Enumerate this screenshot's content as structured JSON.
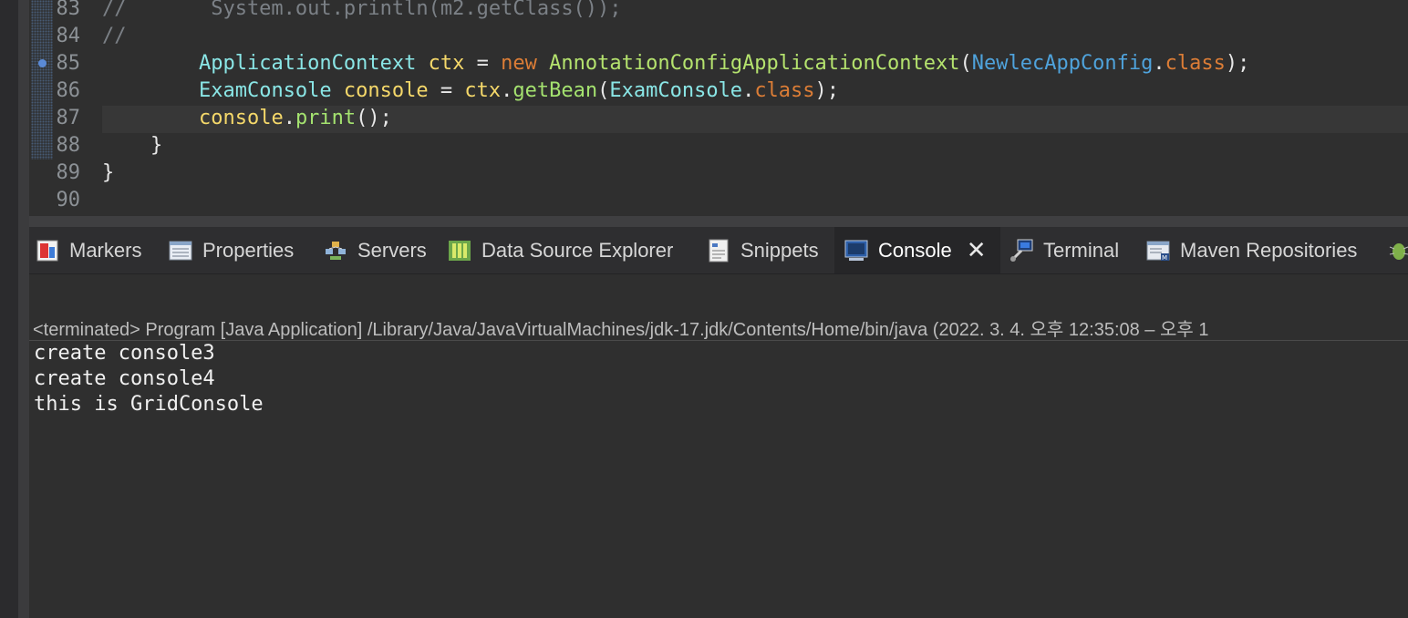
{
  "editor": {
    "lines": [
      {
        "num": "83",
        "tokens": [
          {
            "t": "//       System.out.println(m2.getClass());",
            "c": "cm"
          }
        ]
      },
      {
        "num": "84",
        "tokens": [
          {
            "t": "//",
            "c": "cm"
          }
        ]
      },
      {
        "num": "85",
        "tokens": [
          {
            "t": "        ",
            "c": "pl"
          },
          {
            "t": "ApplicationContext",
            "c": "ty"
          },
          {
            "t": " ",
            "c": "pl"
          },
          {
            "t": "ctx",
            "c": "var"
          },
          {
            "t": " = ",
            "c": "pl"
          },
          {
            "t": "new",
            "c": "kw"
          },
          {
            "t": " ",
            "c": "pl"
          },
          {
            "t": "AnnotationConfigApplicationContext",
            "c": "cls"
          },
          {
            "t": "(",
            "c": "pl"
          },
          {
            "t": "NewlecAppConfig",
            "c": "app"
          },
          {
            "t": ".",
            "c": "pl"
          },
          {
            "t": "class",
            "c": "kw"
          },
          {
            "t": ");",
            "c": "pl"
          }
        ]
      },
      {
        "num": "86",
        "tokens": [
          {
            "t": "        ",
            "c": "pl"
          },
          {
            "t": "ExamConsole",
            "c": "ty"
          },
          {
            "t": " ",
            "c": "pl"
          },
          {
            "t": "console",
            "c": "var"
          },
          {
            "t": " = ",
            "c": "pl"
          },
          {
            "t": "ctx",
            "c": "var"
          },
          {
            "t": ".",
            "c": "pl"
          },
          {
            "t": "getBean",
            "c": "mt"
          },
          {
            "t": "(",
            "c": "pl"
          },
          {
            "t": "ExamConsole",
            "c": "ty"
          },
          {
            "t": ".",
            "c": "pl"
          },
          {
            "t": "class",
            "c": "kw"
          },
          {
            "t": ");",
            "c": "pl"
          }
        ]
      },
      {
        "num": "87",
        "tokens": [
          {
            "t": "        ",
            "c": "pl"
          },
          {
            "t": "console",
            "c": "var"
          },
          {
            "t": ".",
            "c": "pl"
          },
          {
            "t": "print",
            "c": "mt"
          },
          {
            "t": "();",
            "c": "pl"
          }
        ]
      },
      {
        "num": "88",
        "tokens": [
          {
            "t": "    }",
            "c": "pl"
          }
        ]
      },
      {
        "num": "89",
        "tokens": [
          {
            "t": "}",
            "c": "pl"
          }
        ]
      },
      {
        "num": "90",
        "tokens": []
      }
    ]
  },
  "tabs": [
    {
      "label": "Markers",
      "icon": "markers-icon"
    },
    {
      "label": "Properties",
      "icon": "properties-icon"
    },
    {
      "label": "Servers",
      "icon": "servers-icon"
    },
    {
      "label": "Data Source Explorer",
      "icon": "data-source-icon"
    },
    {
      "label": "Snippets",
      "icon": "snippets-icon"
    },
    {
      "label": "Console",
      "icon": "console-icon",
      "active": true
    },
    {
      "label": "Terminal",
      "icon": "terminal-icon"
    },
    {
      "label": "Maven Repositories",
      "icon": "maven-icon"
    },
    {
      "label": "",
      "icon": "debug-icon"
    }
  ],
  "console": {
    "status": "<terminated> Program [Java Application] /Library/Java/JavaVirtualMachines/jdk-17.jdk/Contents/Home/bin/java  (2022. 3. 4. 오후 12:35:08 – 오후 1",
    "output": [
      "create console3",
      "create console4",
      "this is GridConsole"
    ]
  }
}
